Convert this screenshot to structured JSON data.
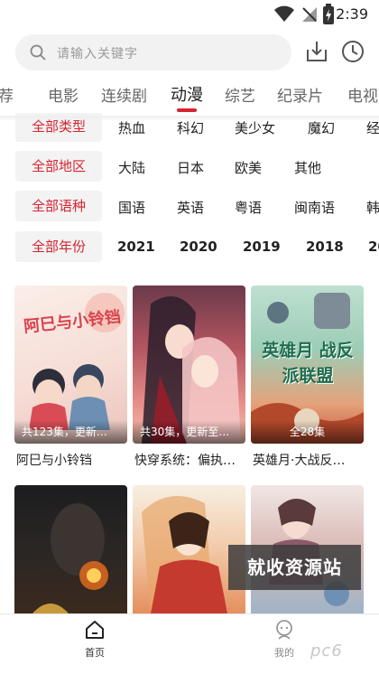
{
  "status": {
    "time": "2:39",
    "battery": "⚡"
  },
  "search": {
    "placeholder": "请输入关键字"
  },
  "tabs": [
    "荐",
    "电影",
    "连续剧",
    "动漫",
    "综艺",
    "纪录片",
    "电视"
  ],
  "active_tab": "动漫",
  "filters": [
    {
      "label": "全部类型",
      "options": [
        "热血",
        "科幻",
        "美少女",
        "魔幻",
        "经"
      ]
    },
    {
      "label": "全部地区",
      "options": [
        "大陆",
        "日本",
        "欧美",
        "其他"
      ]
    },
    {
      "label": "全部语种",
      "options": [
        "国语",
        "英语",
        "粤语",
        "闽南语",
        "韩"
      ]
    },
    {
      "label": "全部年份",
      "options": [
        "2021",
        "2020",
        "2019",
        "2018",
        "20"
      ]
    }
  ],
  "cards": [
    {
      "title": "阿巳与小铃铛",
      "episodes": "共123集，更新…",
      "poster_text": "阿巳与小铃铛"
    },
    {
      "title": "快穿系统：偏执…",
      "episodes": "共30集，更新至…",
      "poster_text": ""
    },
    {
      "title": "英雄月·大战反…",
      "episodes": "全28集",
      "poster_text": "英雄月 战反派联盟"
    },
    {
      "title": "",
      "episodes": "",
      "poster_text": ""
    },
    {
      "title": "",
      "episodes": "",
      "poster_text": ""
    },
    {
      "title": "",
      "episodes": "",
      "poster_text": ""
    }
  ],
  "watermark": "就收资源站",
  "nav": {
    "home": "首页",
    "mine": "我的"
  },
  "brand_watermark": "pc6",
  "colors": {
    "accent": "#d8232f",
    "pill_bg": "#f3f3f3"
  }
}
